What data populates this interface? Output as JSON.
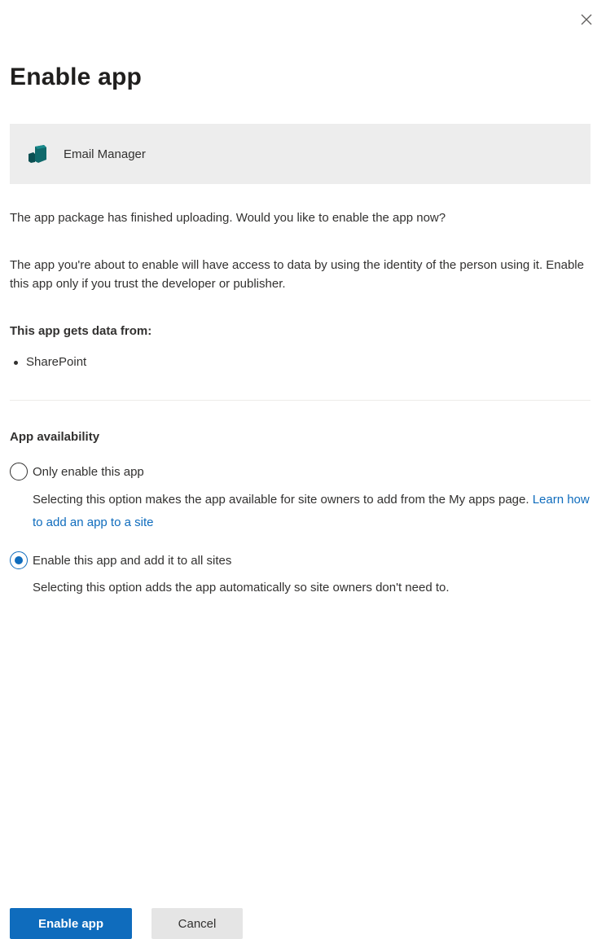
{
  "dialog": {
    "title": "Enable app",
    "app": {
      "name": "Email Manager",
      "icon": "app-package-icon"
    },
    "messages": [
      "The app package has finished uploading. Would you like to enable the app now?",
      "The app you're about to enable will have access to data by using the identity of the person using it. Enable this app only if you trust the developer or publisher."
    ],
    "data_sources": {
      "heading": "This app gets data from:",
      "items": [
        "SharePoint"
      ]
    },
    "availability": {
      "heading": "App availability",
      "options": [
        {
          "label": "Only enable this app",
          "description": "Selecting this option makes the app available for site owners to add from the My apps page.",
          "link_text": "Learn how to add an app to a site",
          "selected": false
        },
        {
          "label": "Enable this app and add it to all sites",
          "description": "Selecting this option adds the app automatically so site owners don't need to.",
          "selected": true
        }
      ]
    },
    "buttons": {
      "primary": "Enable app",
      "secondary": "Cancel"
    }
  },
  "colors": {
    "accent": "#0f6cbd",
    "app_icon": "#10696b",
    "card_background": "#ededed"
  }
}
